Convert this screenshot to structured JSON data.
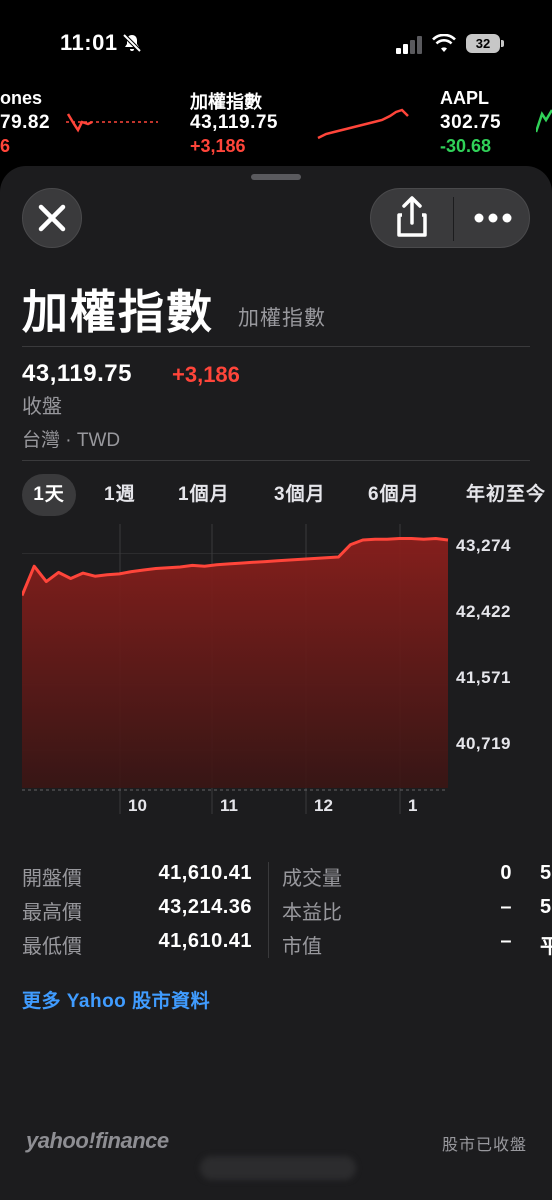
{
  "status_bar": {
    "time": "11:01",
    "battery": "32"
  },
  "tickers": [
    {
      "name": "ones",
      "price": "79.82",
      "change": "6",
      "direction": "down"
    },
    {
      "name": "加權指數",
      "price": "43,119.75",
      "change": "+3,186",
      "direction": "up"
    },
    {
      "name": "AAPL",
      "price": "302.75",
      "change": "-30.68",
      "direction": "down"
    }
  ],
  "header": {
    "close_icon": "close-icon",
    "share_icon": "share-icon",
    "more_icon": "ellipsis-icon"
  },
  "stock": {
    "name": "加權指數",
    "subname": "加權指數",
    "price": "43,119.75",
    "change": "+3,186",
    "status": "收盤",
    "market": "台灣 · TWD"
  },
  "tabs": [
    "1天",
    "1週",
    "1個月",
    "3個月",
    "6個月",
    "年初至今"
  ],
  "active_tab": "1天",
  "chart_data": {
    "type": "area",
    "color": "#ff453a",
    "ylim": [
      40100,
      43450
    ],
    "yticks": [
      "43,274",
      "42,422",
      "41,571",
      "40,719"
    ],
    "xticks": [
      "10",
      "11",
      "12",
      "1"
    ],
    "values": [
      42600,
      42980,
      42780,
      42900,
      42820,
      42890,
      42850,
      42870,
      42880,
      42910,
      42930,
      42950,
      42960,
      42970,
      42990,
      42980,
      43000,
      43010,
      43020,
      43030,
      43040,
      43050,
      43060,
      43070,
      43080,
      43090,
      43100,
      43260,
      43320,
      43330,
      43330,
      43340,
      43340,
      43330,
      43340,
      43320
    ]
  },
  "stats": {
    "col1": [
      {
        "label": "開盤價",
        "value": "41,610.41"
      },
      {
        "label": "最高價",
        "value": "43,214.36"
      },
      {
        "label": "最低價",
        "value": "41,610.41"
      }
    ],
    "col2": [
      {
        "label": "成交量",
        "value": "0"
      },
      {
        "label": "本益比",
        "value": "–"
      },
      {
        "label": "市值",
        "value": "–"
      }
    ],
    "col3_partial": [
      "5",
      "5",
      "平"
    ]
  },
  "more_link": "更多 Yahoo 股市資料",
  "footer": {
    "brand": "yahoo!finance",
    "market_status": "股市已收盤"
  }
}
